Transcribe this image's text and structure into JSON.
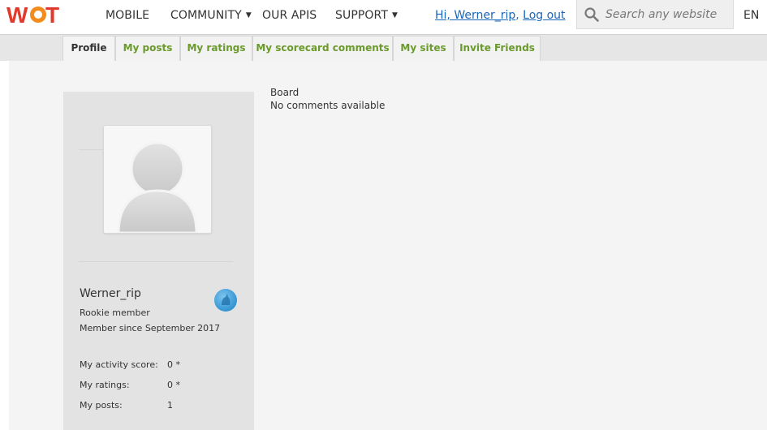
{
  "brand": {
    "logo_text": "WOT",
    "colors": {
      "red": "#e03a2c",
      "orange": "#f28c1d",
      "green": "#6a9a2c"
    }
  },
  "nav": {
    "mobile": "MOBILE",
    "community": "COMMUNITY",
    "our_apis": "OUR APIS",
    "support": "SUPPORT"
  },
  "user": {
    "greeting": "Hi, Werner_rip",
    "separator": ",",
    "logout": "Log out"
  },
  "search": {
    "placeholder": "Search any website",
    "icon": "magnifier-icon"
  },
  "language": "EN",
  "tabs": [
    {
      "label": "Profile",
      "active": true
    },
    {
      "label": "My posts",
      "active": false
    },
    {
      "label": "My ratings",
      "active": false
    },
    {
      "label": "My scorecard comments",
      "active": false
    },
    {
      "label": "My sites",
      "active": false
    },
    {
      "label": "Invite Friends",
      "active": false
    }
  ],
  "profile": {
    "username": "Werner_rip",
    "rank": "Rookie member",
    "member_since": "Member since September 2017",
    "avatar_icon": "default-avatar-icon",
    "badge_icon": "rookie-badge-icon",
    "stats": [
      {
        "label": "My activity score:",
        "value": "0 *"
      },
      {
        "label": "My ratings:",
        "value": "0 *"
      },
      {
        "label": "My posts:",
        "value": "1"
      }
    ]
  },
  "board": {
    "title": "Board",
    "empty_text": "No comments available"
  }
}
